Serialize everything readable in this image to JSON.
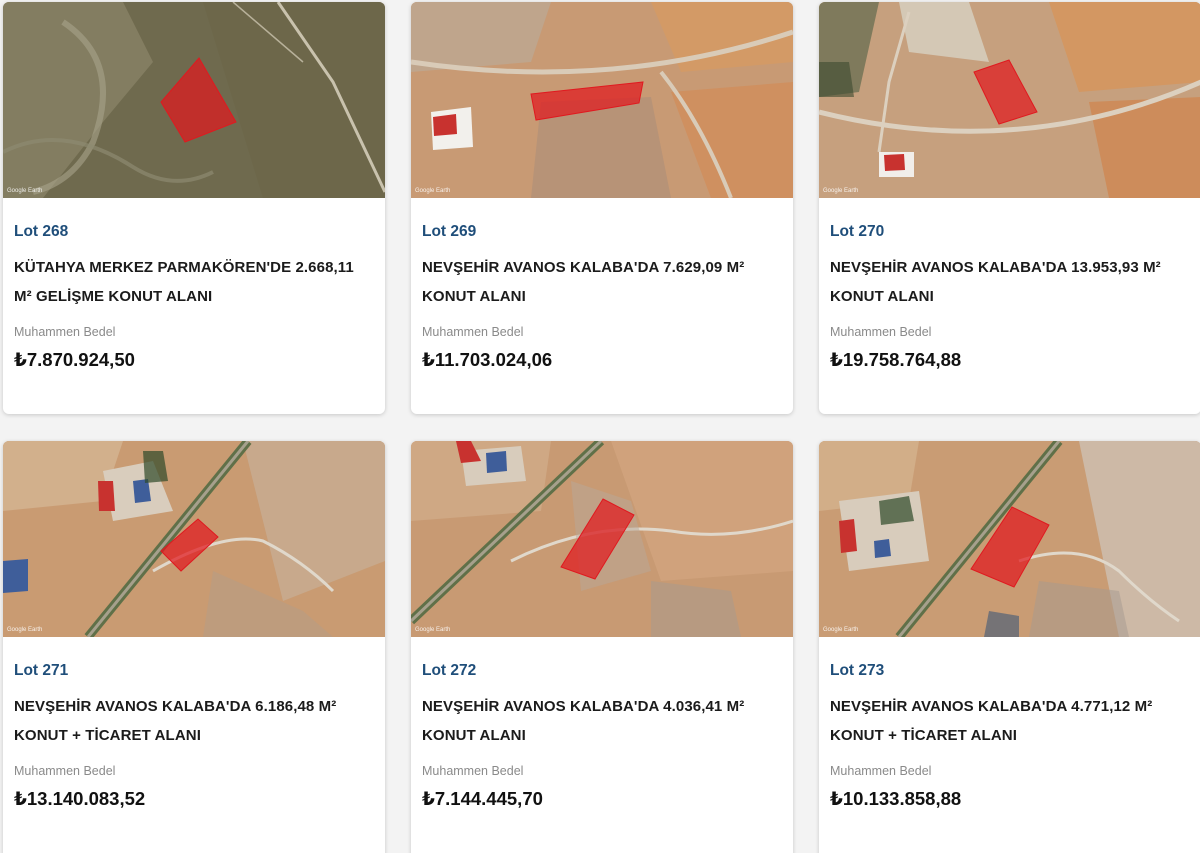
{
  "listing": {
    "price_label": "Muhammen Bedel",
    "map_credit": "Google Earth",
    "colors": {
      "lot_number": "#1f4e7a",
      "parcel_highlight": "#e0191f",
      "card_background": "#ffffff",
      "page_background": "#f3f3f3"
    },
    "lots": [
      {
        "lot": "Lot 268",
        "title_line1": "KÜTAHYA MERKEZ PARMAKÖREN'DE 2.668,11",
        "title_line2": "M² GELİŞME KONUT ALANI",
        "price": "₺7.870.924,50",
        "image": "satellite-map-green-terrain"
      },
      {
        "lot": "Lot 269",
        "title_line1": "NEVŞEHİR AVANOS KALABA'DA 7.629,09 M²",
        "title_line2": "KONUT ALANI",
        "price": "₺11.703.024,06",
        "image": "satellite-map-farmland"
      },
      {
        "lot": "Lot 270",
        "title_line1": "NEVŞEHİR AVANOS KALABA'DA 13.953,93 M²",
        "title_line2": "KONUT ALANI",
        "price": "₺19.758.764,88",
        "image": "satellite-map-farmland"
      },
      {
        "lot": "Lot 271",
        "title_line1": "NEVŞEHİR AVANOS KALABA'DA 6.186,48 M²",
        "title_line2": "KONUT + TİCARET ALANI",
        "price": "₺13.140.083,52",
        "image": "satellite-map-road"
      },
      {
        "lot": "Lot 272",
        "title_line1": "NEVŞEHİR AVANOS KALABA'DA 4.036,41 M²",
        "title_line2": "KONUT ALANI",
        "price": "₺7.144.445,70",
        "image": "satellite-map-road"
      },
      {
        "lot": "Lot 273",
        "title_line1": "NEVŞEHİR AVANOS KALABA'DA 4.771,12 M²",
        "title_line2": "KONUT + TİCARET ALANI",
        "price": "₺10.133.858,88",
        "image": "satellite-map-road"
      }
    ]
  }
}
